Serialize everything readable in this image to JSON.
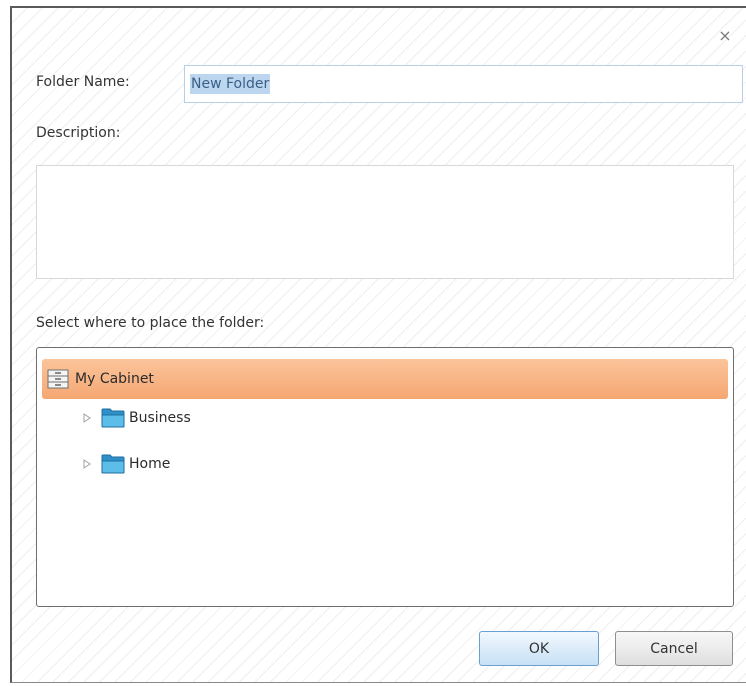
{
  "dialog": {
    "close_glyph": "×",
    "folder_name_label": "Folder Name:",
    "folder_name_value": "New Folder",
    "description_label": "Description:",
    "description_value": "",
    "location_label": "Select where to place the folder:"
  },
  "tree": {
    "root": {
      "label": "My Cabinet",
      "icon": "cabinet-icon",
      "selected": true
    },
    "children": [
      {
        "label": "Business",
        "icon": "folder-icon",
        "expander": "triangle-right-icon"
      },
      {
        "label": "Home",
        "icon": "folder-icon",
        "expander": "triangle-right-icon"
      }
    ]
  },
  "buttons": {
    "ok_label": "OK",
    "cancel_label": "Cancel"
  },
  "colors": {
    "selection": "#f5a772",
    "text_selection": "#bcd6ef",
    "ok_button": "#c7e1f6",
    "folder": "#47a8dc"
  }
}
